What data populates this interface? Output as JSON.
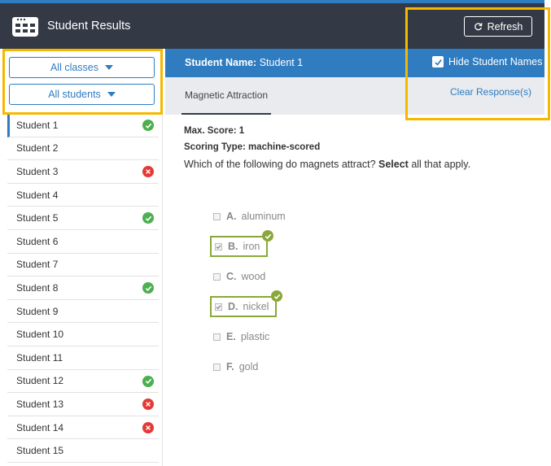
{
  "header": {
    "title": "Student Results",
    "refresh_label": "Refresh",
    "icons": {
      "app": "calendar-grid-icon",
      "refresh": "refresh-icon"
    }
  },
  "sidebar": {
    "class_select": "All classes",
    "student_select": "All students",
    "students": [
      {
        "label": "Student 1",
        "status": "correct"
      },
      {
        "label": "Student 2",
        "status": "none"
      },
      {
        "label": "Student 3",
        "status": "incorrect"
      },
      {
        "label": "Student 4",
        "status": "none"
      },
      {
        "label": "Student 5",
        "status": "correct"
      },
      {
        "label": "Student 6",
        "status": "none"
      },
      {
        "label": "Student 7",
        "status": "none"
      },
      {
        "label": "Student 8",
        "status": "correct"
      },
      {
        "label": "Student 9",
        "status": "none"
      },
      {
        "label": "Student 10",
        "status": "none"
      },
      {
        "label": "Student 11",
        "status": "none"
      },
      {
        "label": "Student 12",
        "status": "correct"
      },
      {
        "label": "Student 13",
        "status": "incorrect"
      },
      {
        "label": "Student 14",
        "status": "incorrect"
      },
      {
        "label": "Student 15",
        "status": "none"
      }
    ],
    "active_index": 0
  },
  "student_bar": {
    "name_label": "Student Name:",
    "name_value": "Student 1",
    "hide_names_label": "Hide Student Names",
    "hide_names_checked": true
  },
  "tabs": {
    "active": "Magnetic Attraction",
    "clear_label": "Clear Response(s)"
  },
  "question": {
    "max_score": "Max. Score: 1",
    "scoring_type": "Scoring Type: machine-scored",
    "prompt_before": "Which of the following do magnets attract? ",
    "prompt_bold": "Select",
    "prompt_after": " all that apply.",
    "options": [
      {
        "letter": "A.",
        "text": "aluminum",
        "checked": false,
        "correct": false
      },
      {
        "letter": "B.",
        "text": "iron",
        "checked": true,
        "correct": true
      },
      {
        "letter": "C.",
        "text": "wood",
        "checked": false,
        "correct": false
      },
      {
        "letter": "D.",
        "text": "nickel",
        "checked": true,
        "correct": true
      },
      {
        "letter": "E.",
        "text": "plastic",
        "checked": false,
        "correct": false
      },
      {
        "letter": "F.",
        "text": "gold",
        "checked": false,
        "correct": false
      }
    ]
  },
  "colors": {
    "header_bg": "#333a46",
    "accent_blue": "#2f7cc0",
    "correct_green": "#4caf50",
    "incorrect_red": "#e53935",
    "answer_green": "#8aa83a",
    "highlight_yellow": "#f5b800"
  }
}
